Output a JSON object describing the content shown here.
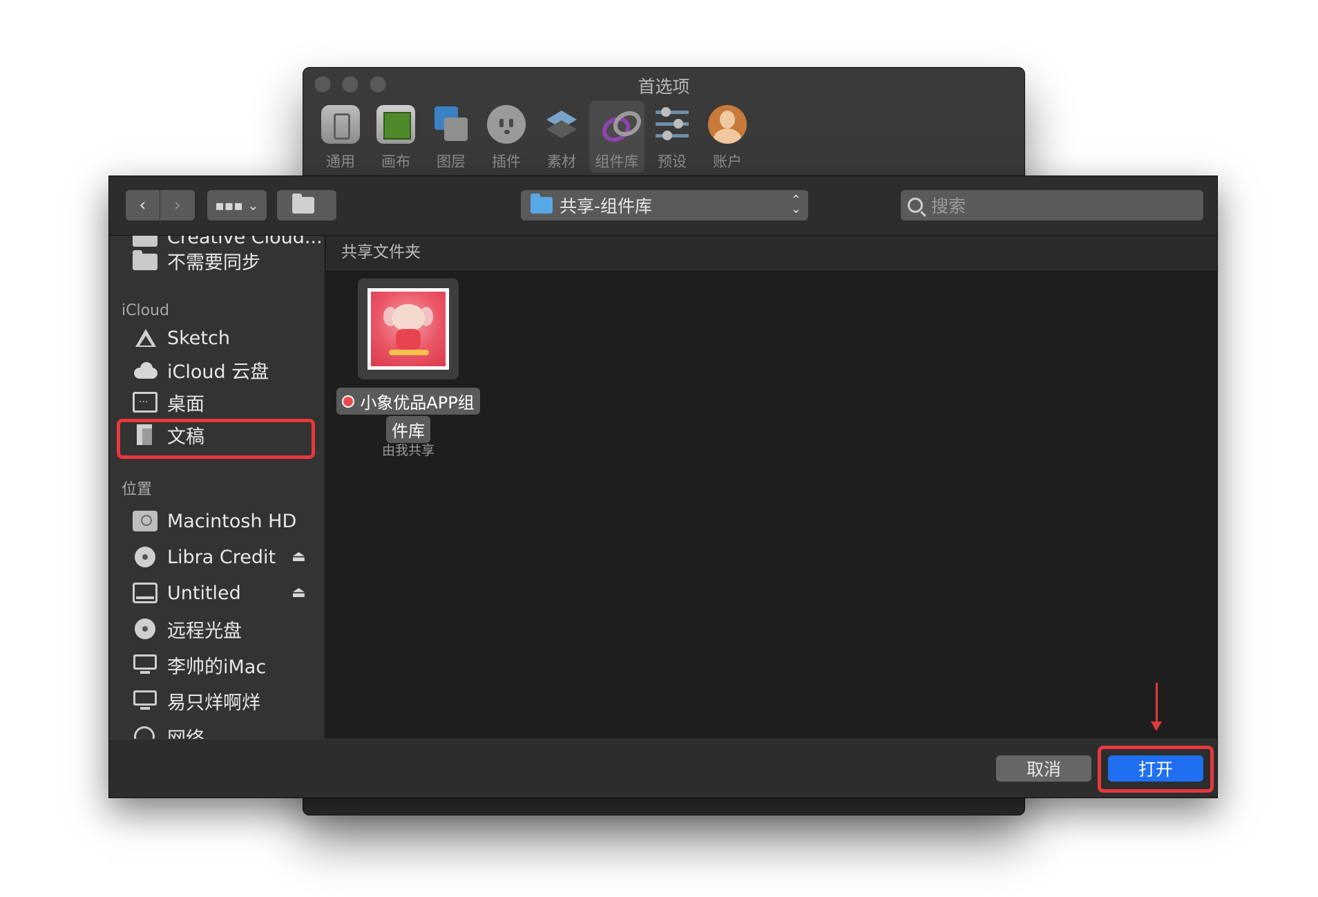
{
  "preferences": {
    "title": "首选项",
    "tabs": [
      {
        "label": "通用",
        "icon": "phone-icon"
      },
      {
        "label": "画布",
        "icon": "canvas-icon"
      },
      {
        "label": "图层",
        "icon": "layers-icon"
      },
      {
        "label": "插件",
        "icon": "plug-icon"
      },
      {
        "label": "素材",
        "icon": "stack-icon"
      },
      {
        "label": "组件库",
        "icon": "link-icon",
        "active": true
      },
      {
        "label": "预设",
        "icon": "sliders-icon"
      },
      {
        "label": "账户",
        "icon": "avatar-icon"
      }
    ]
  },
  "dialog": {
    "toolbar": {
      "back": "‹",
      "forward": "›",
      "view_icon": "▪▪▪ ⌄",
      "new_folder_icon": "new-folder-icon",
      "location": "共享-组件库",
      "search_placeholder": "搜索"
    },
    "sidebar": {
      "partial_top": "Creative Cloud...",
      "items_top": [
        {
          "label": "不需要同步",
          "icon": "folder-icon"
        }
      ],
      "icloud_header": "iCloud",
      "icloud_items": [
        {
          "label": "Sketch",
          "icon": "sketch-icon"
        },
        {
          "label": "iCloud 云盘",
          "icon": "cloud-icon",
          "highlighted": true
        },
        {
          "label": "桌面",
          "icon": "desktop-icon"
        },
        {
          "label": "文稿",
          "icon": "document-icon"
        }
      ],
      "locations_header": "位置",
      "location_items": [
        {
          "label": "Macintosh HD",
          "icon": "hard-drive-icon"
        },
        {
          "label": "Libra Credit",
          "icon": "disc-icon",
          "eject": "⏏"
        },
        {
          "label": "Untitled",
          "icon": "drive-icon",
          "eject": "⏏"
        },
        {
          "label": "远程光盘",
          "icon": "disc-icon"
        },
        {
          "label": "李帅的iMac",
          "icon": "imac-icon"
        },
        {
          "label": "易只烊啊烊",
          "icon": "imac-icon"
        },
        {
          "label": "网络",
          "icon": "network-icon"
        }
      ]
    },
    "content": {
      "group_header": "共享文件夹",
      "file": {
        "name_line1": "小象优品APP组",
        "name_line2": "件库",
        "subtitle": "由我共享",
        "tag_color": "#ef4b4b"
      }
    },
    "footer": {
      "cancel": "取消",
      "open": "打开"
    }
  },
  "colors": {
    "accent": "#1f6ff0",
    "highlight": "#e8383d"
  }
}
